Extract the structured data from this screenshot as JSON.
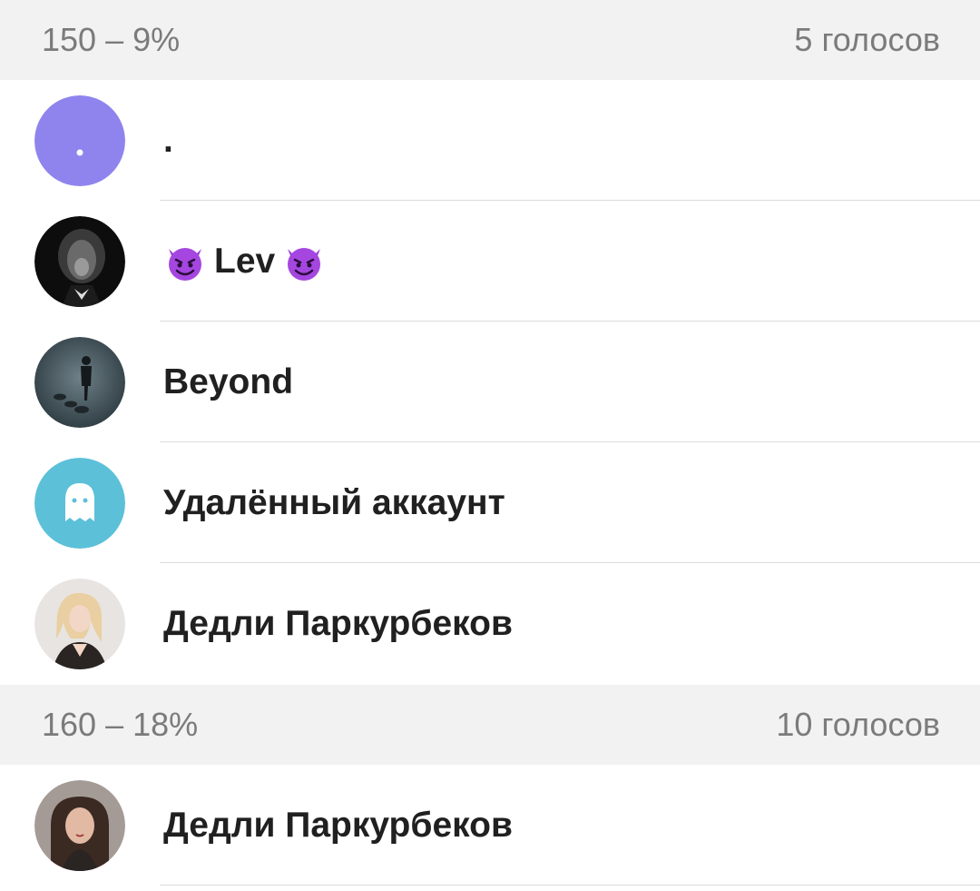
{
  "sections": [
    {
      "label": "150 – 9%",
      "votes": "5 голосов",
      "voters": [
        {
          "name": ".",
          "avatar": "letter-avatar",
          "color": "#8f84ee"
        },
        {
          "name_prefix_icon": "devil-emoji-icon",
          "name": "Lev",
          "name_suffix_icon": "devil-emoji-icon",
          "avatar": "photo-lion"
        },
        {
          "name": "Beyond",
          "avatar": "photo-dark-figure"
        },
        {
          "name": "Удалённый аккаунт",
          "avatar": "ghost-icon",
          "color": "#5cc0d8"
        },
        {
          "name": "Дедли Паркурбеков",
          "avatar": "photo-girl-blonde"
        }
      ]
    },
    {
      "label": "160 – 18%",
      "votes": "10 голосов",
      "voters": [
        {
          "name": "Дедли Паркурбеков",
          "avatar": "photo-girl-brunette"
        }
      ]
    }
  ],
  "colors": {
    "header_bg": "#f2f2f2",
    "header_text": "#7b7b7b",
    "divider": "#dcdcdc",
    "name_text": "#202020"
  }
}
